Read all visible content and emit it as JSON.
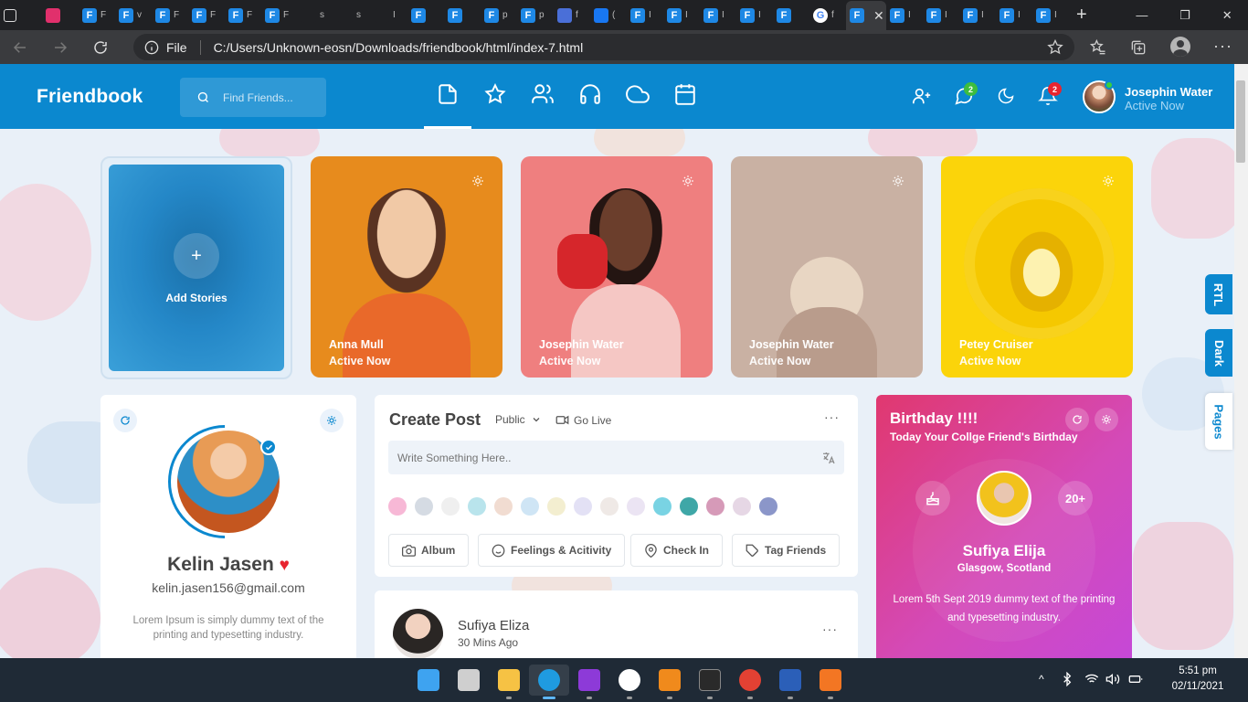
{
  "browser": {
    "tabs": [
      {
        "icon": "window-icon",
        "color": "#202124",
        "letter": ""
      },
      {
        "icon": "instagram-icon",
        "color": "#e1306c",
        "letter": ""
      },
      {
        "icon": "friendbook-icon",
        "color": "#1e88e5",
        "letter": "F",
        "label": "F"
      },
      {
        "icon": "friendbook-icon",
        "color": "#1e88e5",
        "letter": "F",
        "label": "v"
      },
      {
        "icon": "friendbook-icon",
        "color": "#1e88e5",
        "letter": "F",
        "label": "F"
      },
      {
        "icon": "friendbook-icon",
        "color": "#1e88e5",
        "letter": "F",
        "label": "F"
      },
      {
        "icon": "friendbook-icon",
        "color": "#1e88e5",
        "letter": "F",
        "label": "F"
      },
      {
        "icon": "friendbook-icon",
        "color": "#1e88e5",
        "letter": "F",
        "label": "F"
      },
      {
        "icon": "github-icon",
        "color": "#202124",
        "letter": "",
        "label": "s"
      },
      {
        "icon": "document-icon",
        "color": "#202124",
        "letter": "",
        "label": "s"
      },
      {
        "icon": "terminal-icon",
        "color": "#202124",
        "letter": "",
        "label": "I"
      },
      {
        "icon": "friendbook-icon",
        "color": "#1e88e5",
        "letter": "F",
        "label": ""
      },
      {
        "icon": "friendbook-icon",
        "color": "#1e88e5",
        "letter": "F",
        "label": ""
      },
      {
        "icon": "friendbook-icon",
        "color": "#1e88e5",
        "letter": "F",
        "label": "p"
      },
      {
        "icon": "friendbook-icon",
        "color": "#1e88e5",
        "letter": "F",
        "label": "p"
      },
      {
        "icon": "feed-icon",
        "color": "#4a6fd8",
        "letter": "",
        "label": "f"
      },
      {
        "icon": "facebook-icon",
        "color": "#1877f2",
        "letter": "",
        "label": "("
      },
      {
        "icon": "friendbook-icon",
        "color": "#1e88e5",
        "letter": "F",
        "label": "I"
      },
      {
        "icon": "friendbook-icon",
        "color": "#1e88e5",
        "letter": "F",
        "label": "I"
      },
      {
        "icon": "friendbook-icon",
        "color": "#1e88e5",
        "letter": "F",
        "label": "I"
      },
      {
        "icon": "friendbook-icon",
        "color": "#1e88e5",
        "letter": "F",
        "label": "I"
      },
      {
        "icon": "friendbook-icon",
        "color": "#1e88e5",
        "letter": "F",
        "label": ""
      },
      {
        "icon": "google-icon",
        "color": "#ffffff",
        "letter": "G",
        "label": "f"
      },
      {
        "icon": "friendbook-icon",
        "color": "#1e88e5",
        "letter": "F",
        "label": "F",
        "active": true
      },
      {
        "icon": "friendbook-icon",
        "color": "#1e88e5",
        "letter": "F",
        "label": "I"
      },
      {
        "icon": "friendbook-icon",
        "color": "#1e88e5",
        "letter": "F",
        "label": "I"
      },
      {
        "icon": "friendbook-icon",
        "color": "#1e88e5",
        "letter": "F",
        "label": "I"
      },
      {
        "icon": "friendbook-icon",
        "color": "#1e88e5",
        "letter": "F",
        "label": "I"
      },
      {
        "icon": "friendbook-icon",
        "color": "#1e88e5",
        "letter": "F",
        "label": "I"
      }
    ],
    "address": {
      "scheme_label": "File",
      "url": "C:/Users/Unknown-eosn/Downloads/friendbook/html/index-7.html"
    }
  },
  "header": {
    "logo": "Friendbook",
    "search_placeholder": "Find Friends...",
    "chat_badge": "2",
    "notification_badge": "2",
    "user_name": "Josephin Water",
    "user_status": "Active Now",
    "accent": "#0b88cf"
  },
  "side_tabs": {
    "rtl": "RTL",
    "dark": "Dark",
    "pages": "Pages"
  },
  "stories": {
    "add_label": "Add Stories",
    "items": [
      {
        "name": "Anna Mull",
        "status": "Active Now",
        "color": "#e78b1d"
      },
      {
        "name": "Josephin Water",
        "status": "Active Now",
        "color": "#ef7f7f"
      },
      {
        "name": "Josephin Water",
        "status": "Active Now",
        "color": "#c9b1a3"
      },
      {
        "name": "Petey Cruiser",
        "status": "Active Now",
        "color": "#fbd40a"
      }
    ]
  },
  "profile": {
    "name": "Kelin Jasen",
    "email": "kelin.jasen156@gmail.com",
    "bio": "Lorem Ipsum is simply dummy text of the printing and typesetting industry."
  },
  "create_post": {
    "title": "Create Post",
    "privacy": "Public",
    "go_live": "Go Live",
    "placeholder": "Write Something Here..",
    "swatches": [
      "#f7b8d6",
      "#d5dbe3",
      "#efefef",
      "#b9e4ec",
      "#f1dcd1",
      "#cfe5f5",
      "#f3eed0",
      "#e3e1f5",
      "#efe9e6",
      "#ebe4f3",
      "#79d3e3",
      "#3fa7a7",
      "#d69ab8",
      "#e6d7e5",
      "#8b96c9"
    ],
    "actions": [
      "Album",
      "Feelings & Acitivity",
      "Check In",
      "Tag Friends"
    ]
  },
  "post": {
    "author": "Sufiya Eliza",
    "time": "30 Mins Ago"
  },
  "birthday": {
    "title": "Birthday !!!!",
    "subtitle": "Today Your Collge Friend's Birthday",
    "count": "20+",
    "name": "Sufiya Elija",
    "location": "Glasgow, Scotland",
    "text": "Lorem 5th Sept 2019 dummy text of the printing and typesetting industry."
  },
  "taskbar": {
    "apps": [
      "windows-start-icon",
      "task-view-icon",
      "file-explorer-icon",
      "edge-icon",
      "phpstorm-icon",
      "slack-icon",
      "sublime-icon",
      "terminal-icon",
      "chrome-icon",
      "word-icon",
      "xampp-icon"
    ],
    "time": "5:51 pm",
    "date": "02/11/2021"
  }
}
